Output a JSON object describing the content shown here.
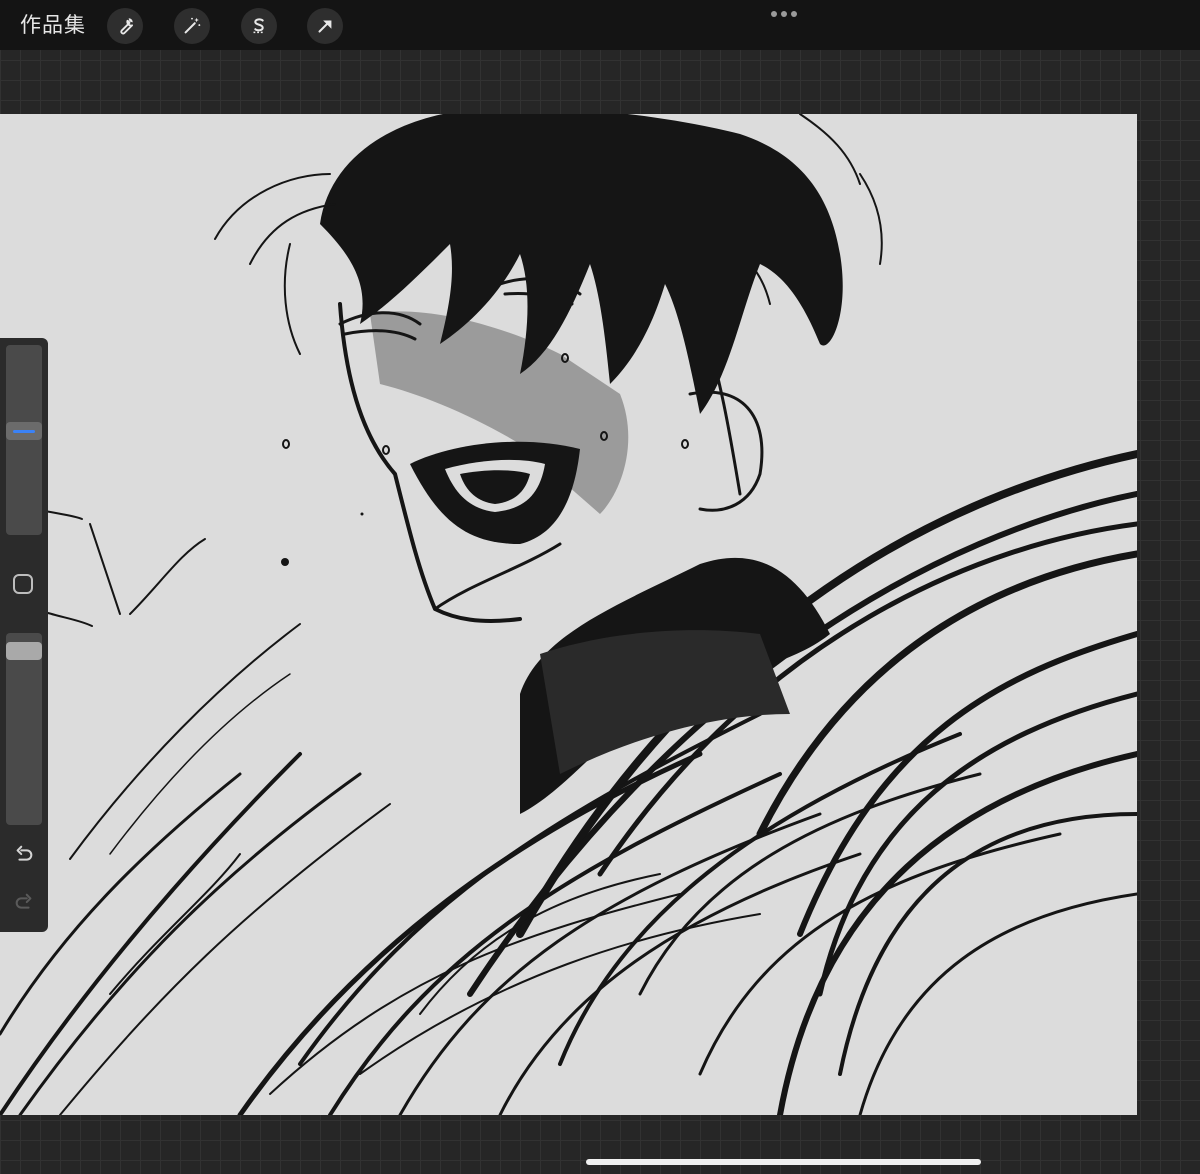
{
  "topbar": {
    "gallery_label": "作品集",
    "tools": [
      {
        "name": "actions",
        "icon": "wrench-icon"
      },
      {
        "name": "adjustments",
        "icon": "magic-wand-icon"
      },
      {
        "name": "selection",
        "icon": "selection-s-icon"
      },
      {
        "name": "transform",
        "icon": "arrow-cursor-icon"
      }
    ],
    "more_icon": "more-dots-icon"
  },
  "sidebar": {
    "brush_size_level": 0.55,
    "brush_opacity_level": 0.95,
    "modify_icon": "rounded-square-icon",
    "undo_icon": "undo-arrow-icon",
    "redo_icon": "redo-arrow-icon",
    "redo_enabled": false
  },
  "canvas": {
    "background": "#dcdcdc",
    "ink": "#151515",
    "shade": "#8f8f8f",
    "content": "grayscale ink sketch of a shouting dark-haired man"
  },
  "colors": {
    "topbar": "#141414",
    "workspace": "#262626",
    "accent": "#3b82f6"
  }
}
